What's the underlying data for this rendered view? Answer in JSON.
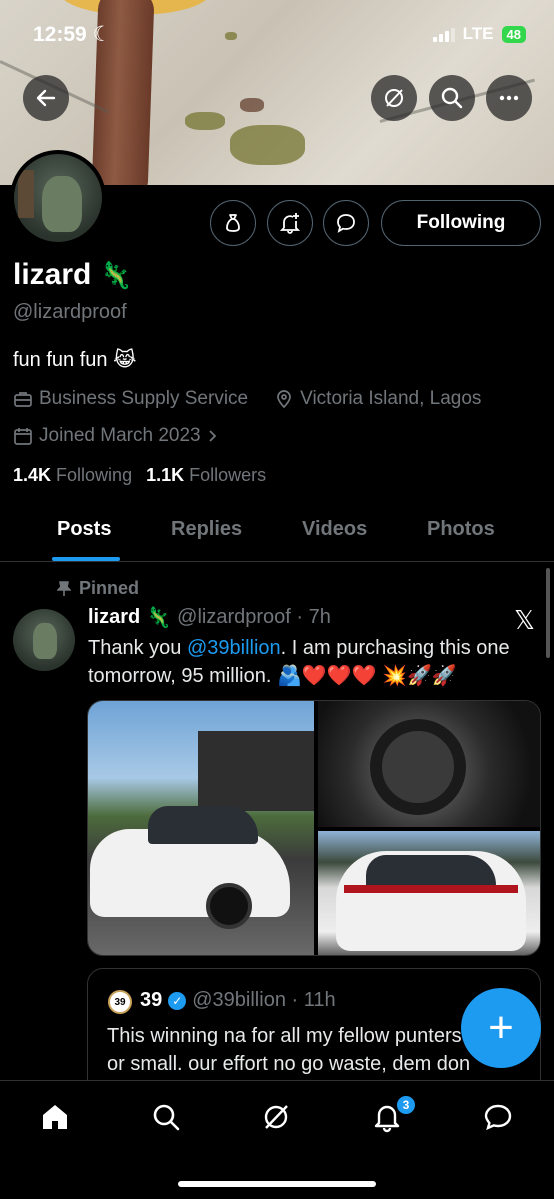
{
  "status_bar": {
    "time": "12:59",
    "network": "LTE",
    "battery": "48"
  },
  "header": {
    "back_label": "back",
    "grok_label": "grok",
    "search_label": "search",
    "more_label": "more"
  },
  "profile": {
    "display_name": "lizard",
    "name_emoji": "🦎",
    "handle": "@lizardproof",
    "bio": "fun fun fun 😹",
    "category": "Business Supply Service",
    "location": "Victoria Island, Lagos",
    "joined": "Joined March 2023",
    "following_count": "1.4K",
    "following_label": "Following",
    "followers_count": "1.1K",
    "followers_label": "Followers",
    "follow_button": "Following"
  },
  "tabs": [
    "Posts",
    "Replies",
    "Videos",
    "Photos"
  ],
  "post": {
    "pinned_label": "Pinned",
    "author": "lizard",
    "author_emoji": "🦎",
    "handle_time": "@lizardproof · 7h",
    "text_prefix": "Thank you ",
    "mention": "@39billion",
    "text_suffix": ". I am purchasing this one tomorrow, 95 million. 🫂❤️❤️❤️ 💥🚀🚀",
    "quote": {
      "avatar_text": "39",
      "author": "39",
      "handle_time": "@39billion · 11h",
      "line1": "This winning na for all my fellow punters big",
      "line2": "or small. our effort no go waste, dem don"
    }
  },
  "fab_label": "+",
  "bottom_nav": {
    "notifications_badge": "3"
  },
  "colors": {
    "accent": "#1d9bf0",
    "secondary_text": "#71767b",
    "border": "#2f3336"
  }
}
